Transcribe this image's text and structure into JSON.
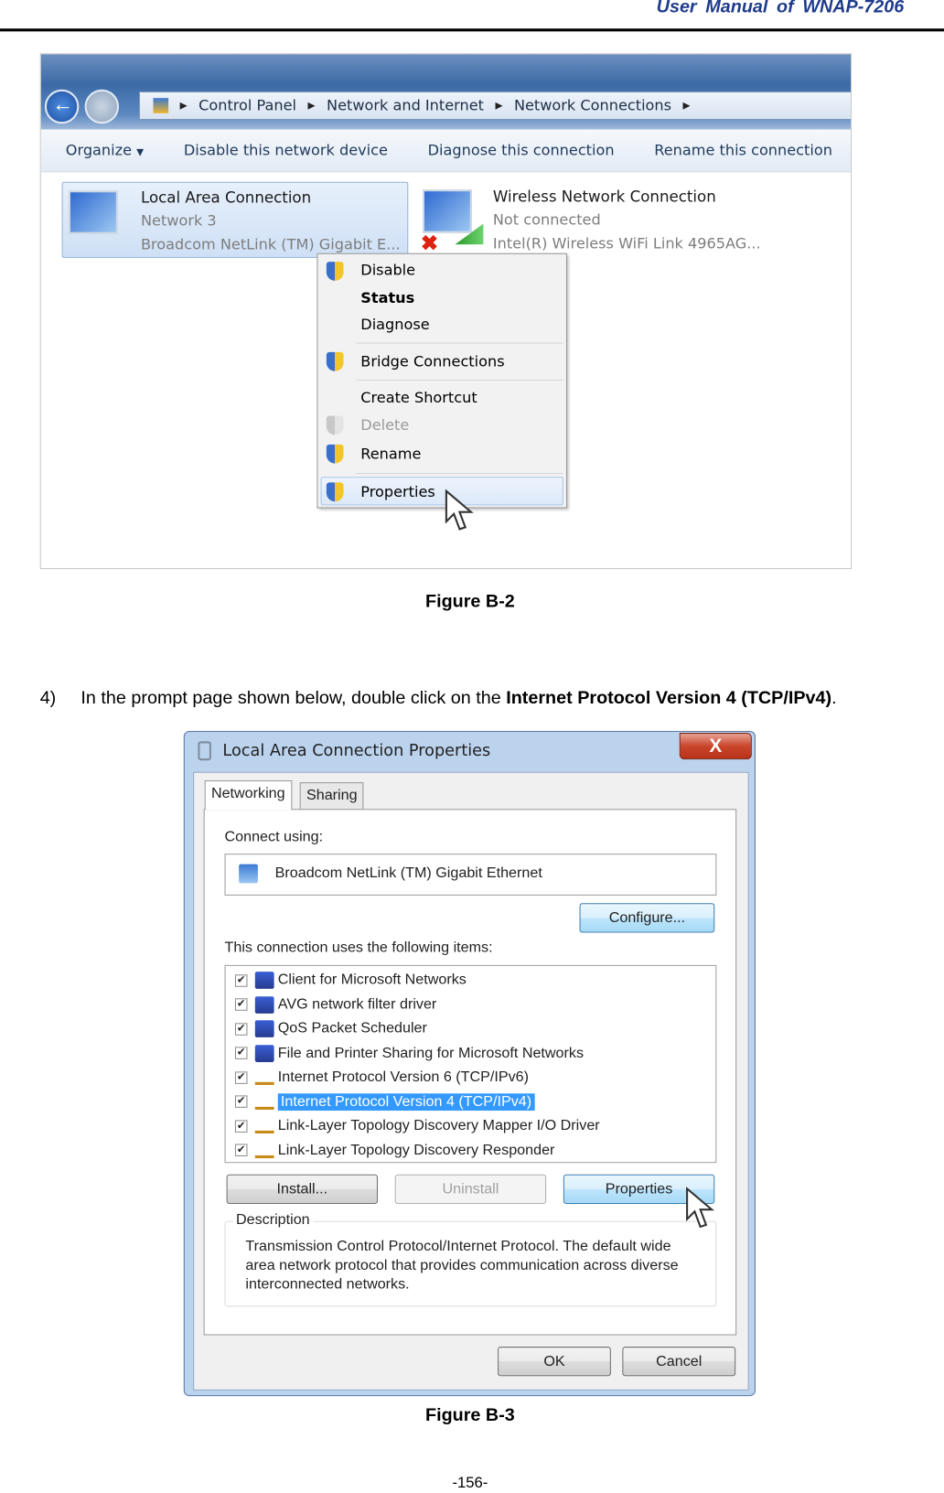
{
  "header": {
    "title": "User Manual of WNAP-7206"
  },
  "figure_b2": {
    "breadcrumb": [
      "Control Panel",
      "Network and Internet",
      "Network Connections"
    ],
    "toolbar": [
      "Organize",
      "Disable this network device",
      "Diagnose this connection",
      "Rename this connection"
    ],
    "connections": [
      {
        "name": "Local Area Connection",
        "status": "Network  3",
        "device": "Broadcom NetLink (TM) Gigabit E..."
      },
      {
        "name": "Wireless Network Connection",
        "status": "Not connected",
        "device": "Intel(R) Wireless WiFi Link 4965AG..."
      }
    ],
    "context_menu": [
      "Disable",
      "Status",
      "Diagnose",
      "Bridge Connections",
      "Create Shortcut",
      "Delete",
      "Rename",
      "Properties"
    ],
    "caption": "Figure B-2"
  },
  "step": {
    "number": "4)",
    "text_before": "In the prompt page shown below, double click on the ",
    "bold": "Internet Protocol Version 4 (TCP/IPv4)",
    "text_after": "."
  },
  "figure_b3": {
    "title": "Local Area Connection Properties",
    "close": "X",
    "tabs": [
      "Networking",
      "Sharing"
    ],
    "connect_using_label": "Connect using:",
    "adapter": "Broadcom NetLink (TM) Gigabit Ethernet",
    "configure": "Configure...",
    "items_label": "This connection uses the following items:",
    "items": [
      {
        "label": "Client for Microsoft Networks",
        "checked": true,
        "icon": "client-icon"
      },
      {
        "label": "AVG network filter driver",
        "checked": true,
        "icon": "service-icon"
      },
      {
        "label": "QoS Packet Scheduler",
        "checked": true,
        "icon": "service-icon"
      },
      {
        "label": "File and Printer Sharing for Microsoft Networks",
        "checked": true,
        "icon": "service-icon"
      },
      {
        "label": "Internet Protocol Version 6 (TCP/IPv6)",
        "checked": true,
        "icon": "protocol-icon"
      },
      {
        "label": "Internet Protocol Version 4 (TCP/IPv4)",
        "checked": true,
        "icon": "protocol-icon",
        "selected": true
      },
      {
        "label": "Link-Layer Topology Discovery Mapper I/O Driver",
        "checked": true,
        "icon": "protocol-icon"
      },
      {
        "label": "Link-Layer Topology Discovery Responder",
        "checked": true,
        "icon": "protocol-icon"
      }
    ],
    "install": "Install...",
    "uninstall": "Uninstall",
    "properties": "Properties",
    "description_label": "Description",
    "description": "Transmission Control Protocol/Internet Protocol. The default wide area network protocol that provides communication across diverse interconnected networks.",
    "ok": "OK",
    "cancel": "Cancel",
    "caption": "Figure B-3"
  },
  "footer": {
    "page": "-156-"
  }
}
